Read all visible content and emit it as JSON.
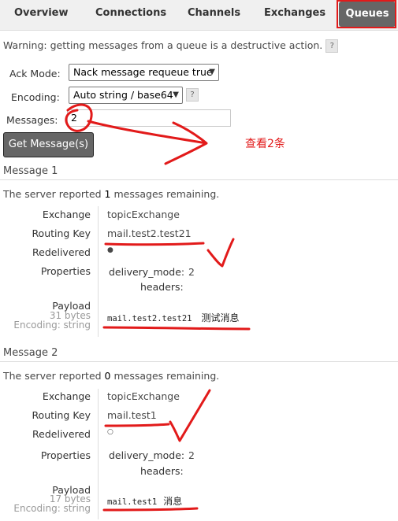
{
  "nav": {
    "tabs": [
      "Overview",
      "Connections",
      "Channels",
      "Exchanges",
      "Queues"
    ],
    "active": "Queues"
  },
  "warning": "Warning: getting messages from a queue is a destructive action.",
  "help_glyph": "?",
  "form": {
    "ack_mode_label": "Ack Mode:",
    "ack_mode_value": "Nack message requeue true",
    "encoding_label": "Encoding:",
    "encoding_value": "Auto string / base64",
    "messages_label": "Messages:",
    "messages_value": "2",
    "get_button": "Get Message(s)"
  },
  "annotation_note": "查看2条",
  "messages": [
    {
      "title": "Message 1",
      "remaining_prefix": "The server reported ",
      "remaining_count": "1",
      "remaining_suffix": " messages remaining.",
      "exchange_label": "Exchange",
      "exchange": "topicExchange",
      "routing_key_label": "Routing Key",
      "routing_key": "mail.test2.test21",
      "redelivered_label": "Redelivered",
      "redelivered": "●",
      "properties_label": "Properties",
      "delivery_mode_label": "delivery_mode:",
      "delivery_mode": "2",
      "headers_label": "headers:",
      "payload_label": "Payload",
      "payload_size": "31 bytes",
      "payload_encoding": "Encoding: string",
      "payload": "mail.test2.test21",
      "payload_cn": "测试消息"
    },
    {
      "title": "Message 2",
      "remaining_prefix": "The server reported ",
      "remaining_count": "0",
      "remaining_suffix": " messages remaining.",
      "exchange_label": "Exchange",
      "exchange": "topicExchange",
      "routing_key_label": "Routing Key",
      "routing_key": "mail.test1",
      "redelivered_label": "Redelivered",
      "redelivered": "○",
      "properties_label": "Properties",
      "delivery_mode_label": "delivery_mode:",
      "delivery_mode": "2",
      "headers_label": "headers:",
      "payload_label": "Payload",
      "payload_size": "17 bytes",
      "payload_encoding": "Encoding: string",
      "payload": "mail.test1",
      "payload_cn": "消息"
    }
  ],
  "colors": {
    "ink": "#e21a1a",
    "button": "#666666",
    "active_tab": "#666666"
  }
}
